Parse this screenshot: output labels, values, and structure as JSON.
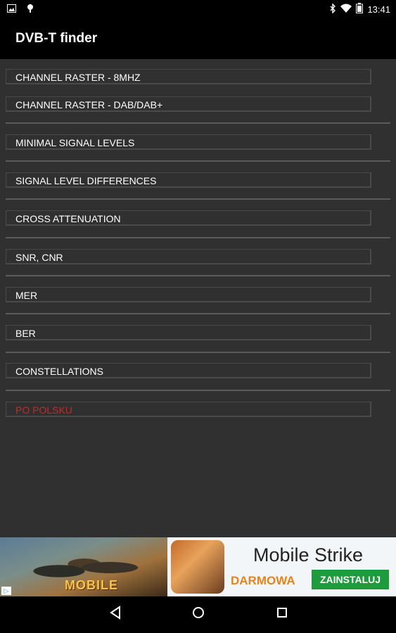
{
  "status_bar": {
    "time": "13:41",
    "icons": [
      "image-icon",
      "android-icon",
      "bluetooth-icon",
      "wifi-icon",
      "battery-icon"
    ]
  },
  "app_bar": {
    "title": "DVB-T finder"
  },
  "menu": {
    "items": [
      {
        "label": "CHANNEL RASTER - 8MHZ"
      },
      {
        "label": "CHANNEL RASTER - DAB/DAB+"
      },
      {
        "label": "MINIMAL SIGNAL LEVELS"
      },
      {
        "label": "SIGNAL LEVEL DIFFERENCES"
      },
      {
        "label": "CROSS ATTENUATION"
      },
      {
        "label": "SNR, CNR"
      },
      {
        "label": "MER"
      },
      {
        "label": "BER"
      },
      {
        "label": "CONSTELLATIONS"
      },
      {
        "label": "PO POLSKU",
        "color": "#c62828"
      }
    ]
  },
  "ad": {
    "banner_logo": "MOBILE",
    "app_name": "Mobile Strike",
    "free_label": "DARMOWA",
    "install_label": "ZAINSTALUJ",
    "adchoice_icon": "ad-choices-icon"
  },
  "nav_bar": {
    "buttons": [
      "back-icon",
      "home-icon",
      "recents-icon"
    ]
  },
  "colors": {
    "background": "#303030",
    "bar": "#000000",
    "text": "#ffffff",
    "accent_red": "#c62828",
    "install_green": "#1e9b3c",
    "free_orange": "#e8821a"
  }
}
